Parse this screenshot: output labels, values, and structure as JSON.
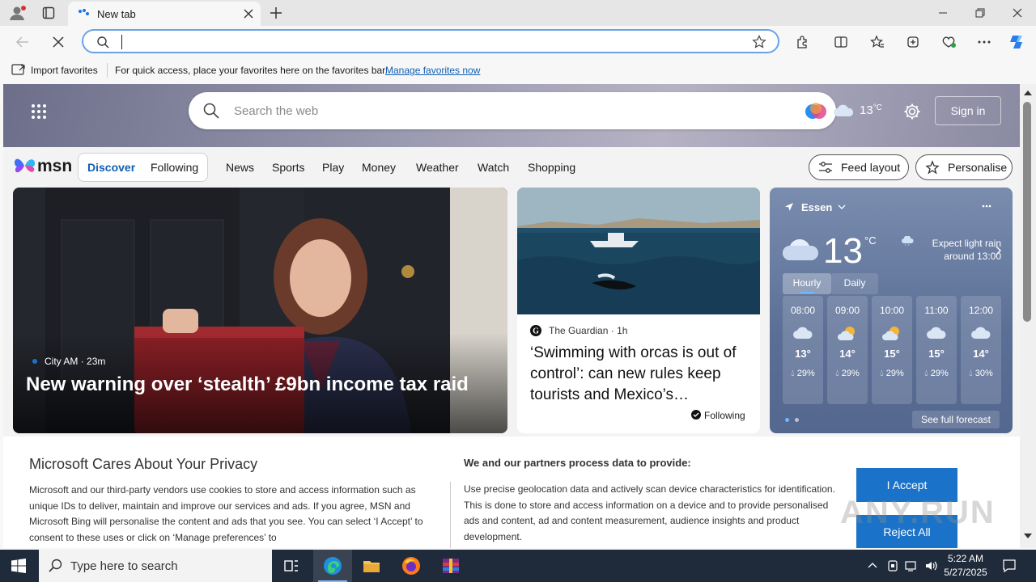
{
  "browser": {
    "tab_title": "New tab",
    "favorites_bar": {
      "import_label": "Import favorites",
      "message": "For quick access, place your favorites here on the favorites bar.",
      "manage_link": "Manage favorites now"
    }
  },
  "msn": {
    "search_placeholder": "Search the web",
    "weather_temp_small": "13",
    "weather_unit_small": "°C",
    "sign_in": "Sign in",
    "logo_text": "msn",
    "tabs": [
      "Discover",
      "Following"
    ],
    "nav": [
      "News",
      "Sports",
      "Play",
      "Money",
      "Weather",
      "Watch",
      "Shopping"
    ],
    "feed_layout": "Feed layout",
    "personalise": "Personalise",
    "card_main": {
      "source": "City AM",
      "time": "23m",
      "headline": "New warning over ‘stealth’ £9bn income tax raid"
    },
    "card_side": {
      "source": "The Guardian",
      "time": "1h",
      "headline": "‘Swimming with orcas is out of control’: can new rules keep tourists and Mexico’s…",
      "following": "Following"
    },
    "weather": {
      "location": "Essen",
      "temp": "13",
      "unit": "°C",
      "summary_line1": "Expect light rain",
      "summary_line2": "around 13:00",
      "tabs": [
        "Hourly",
        "Daily"
      ],
      "hourly": [
        {
          "time": "08:00",
          "temp": "13°",
          "rain": "29%",
          "icon": "cloud-icon"
        },
        {
          "time": "09:00",
          "temp": "14°",
          "rain": "29%",
          "icon": "partly-sunny-icon"
        },
        {
          "time": "10:00",
          "temp": "15°",
          "rain": "29%",
          "icon": "partly-sunny-icon"
        },
        {
          "time": "11:00",
          "temp": "15°",
          "rain": "29%",
          "icon": "cloud-icon"
        },
        {
          "time": "12:00",
          "temp": "14°",
          "rain": "30%",
          "icon": "cloud-icon"
        }
      ],
      "see_full": "See full forecast"
    }
  },
  "privacy": {
    "title": "Microsoft Cares About Your Privacy",
    "body": "Microsoft and our third-party vendors use cookies to store and access information such as unique IDs to deliver, maintain and improve our services and ads. If you agree, MSN and Microsoft Bing will personalise the content and ads that you see. You can select ‘I Accept’ to consent to these uses or click on ‘Manage preferences’ to",
    "right_title": "We and our partners process data to provide:",
    "right_body": "Use precise geolocation data and actively scan device characteristics for identification. This is done to store and access information on a device and to provide personalised ads and content, ad and content measurement, audience insights and product development.",
    "accept": "I Accept",
    "reject": "Reject All"
  },
  "watermark": "ANY.RUN",
  "taskbar": {
    "search_placeholder": "Type here to search",
    "time": "5:22 AM",
    "date": "5/27/2025"
  }
}
